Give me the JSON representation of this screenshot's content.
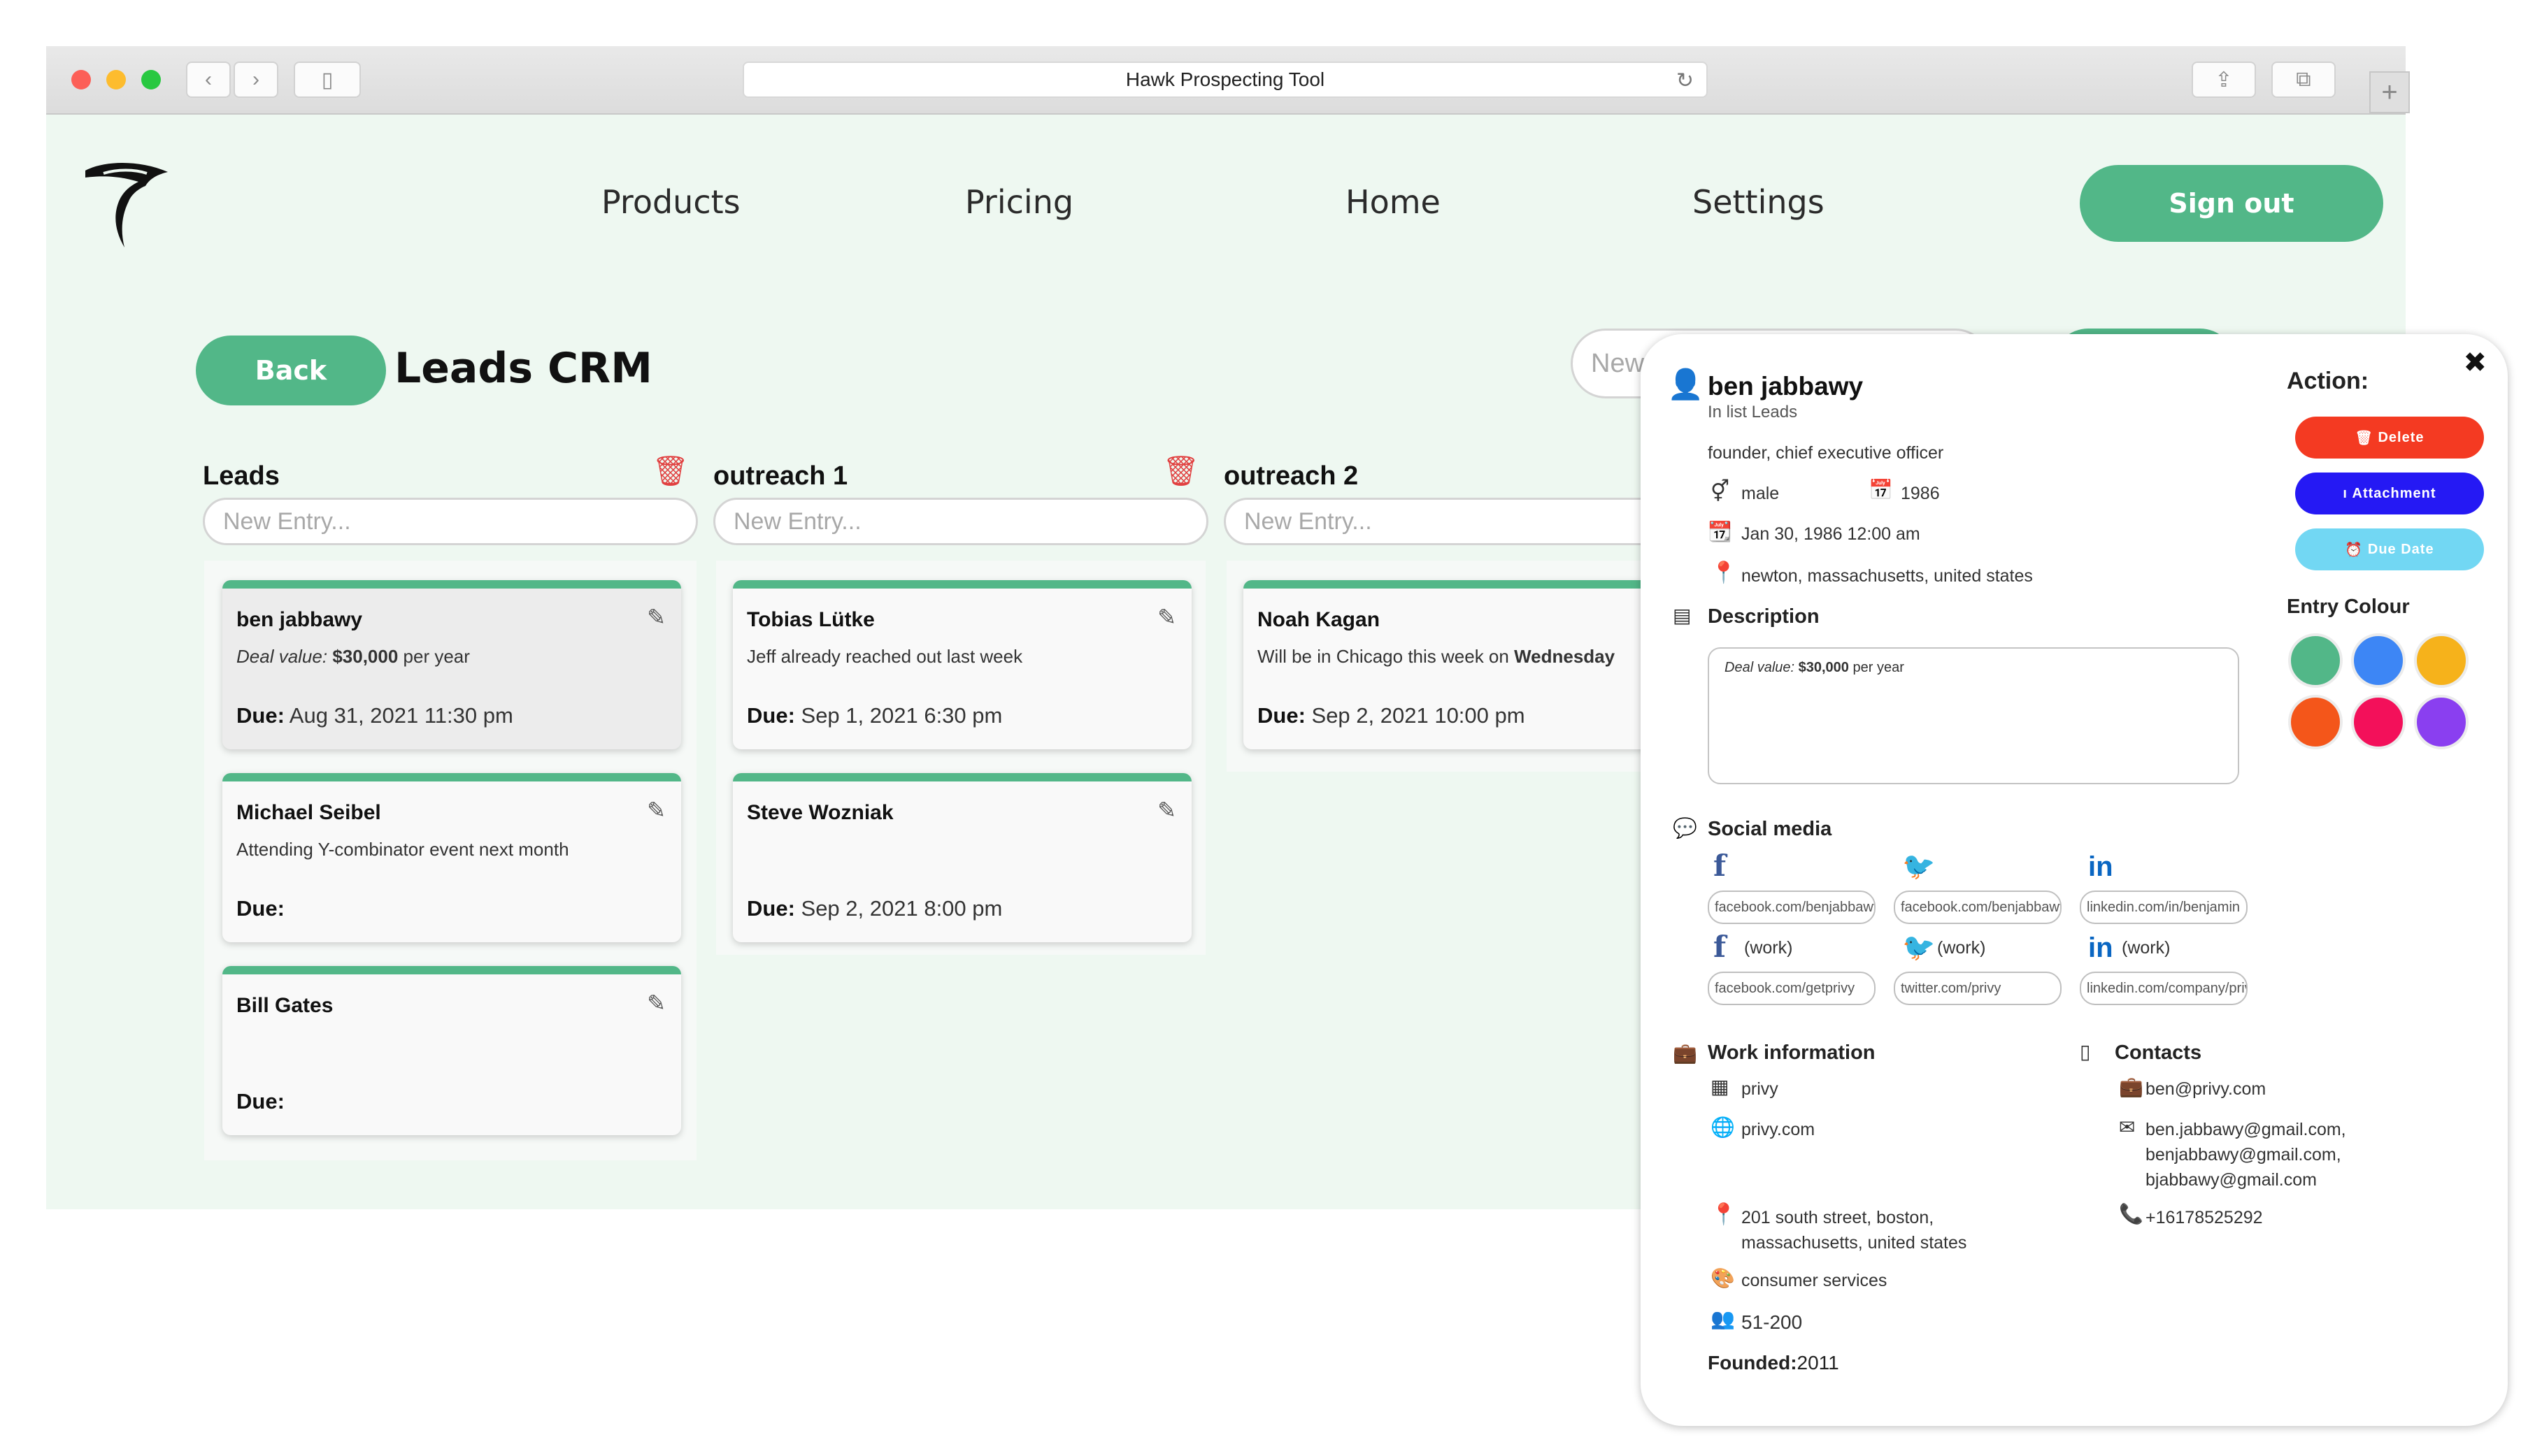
{
  "browser": {
    "url_title": "Hawk Prospecting Tool",
    "back_glyph": "‹",
    "forward_glyph": "›",
    "sidebar_glyph": "▯",
    "reload_glyph": "↻",
    "share_glyph": "⇪",
    "tabs_glyph": "⧉",
    "newtab_glyph": "+"
  },
  "nav": {
    "items": [
      "Products",
      "Pricing",
      "Home",
      "Settings"
    ],
    "signout_label": "Sign out"
  },
  "page": {
    "back_label": "Back",
    "title": "Leads CRM",
    "new_list_placeholder": "New"
  },
  "columns": [
    {
      "title": "Leads",
      "entry_placeholder": "New Entry...",
      "cards": [
        {
          "name": "ben jabbawy",
          "desc_prefix": "Deal value:",
          "desc_bold": "$30,000",
          "desc_suffix": "per year",
          "due_label": "Due:",
          "due_value": "Aug 31, 2021 11:30 pm"
        },
        {
          "name": "Michael Seibel",
          "desc": "Attending Y-combinator event next month",
          "due_label": "Due:",
          "due_value": ""
        },
        {
          "name": "Bill Gates",
          "desc": "",
          "due_label": "Due:",
          "due_value": ""
        }
      ]
    },
    {
      "title": "outreach 1",
      "entry_placeholder": "New Entry...",
      "cards": [
        {
          "name": "Tobias Lütke",
          "desc": "Jeff already reached out last week",
          "due_label": "Due:",
          "due_value": "Sep 1, 2021 6:30 pm"
        },
        {
          "name": "Steve Wozniak",
          "desc": "",
          "due_label": "Due:",
          "due_value": "Sep 2, 2021 8:00 pm"
        }
      ]
    },
    {
      "title": "outreach 2",
      "entry_placeholder": "New Entry...",
      "cards": [
        {
          "name": "Noah Kagan",
          "desc_prefix": "Will be in Chicago this week on",
          "desc_bold": "Wednesday",
          "due_label": "Due:",
          "due_value": "Sep 2, 2021 10:00 pm"
        }
      ]
    }
  ],
  "panel": {
    "close_glyph": "✖",
    "name": "ben jabbawy",
    "list_text": "In list Leads",
    "title_text": "founder, chief executive officer",
    "gender": "male",
    "birth_year": "1986",
    "birth_date": "Jan 30, 1986 12:00 am",
    "location": "newton, massachusetts, united states",
    "description_label": "Description",
    "description_prefix": "Deal value:",
    "description_bold": "$30,000",
    "description_suffix": "per year",
    "action_label": "Action:",
    "actions": {
      "delete": "Delete",
      "attachment": "Attachment",
      "due_date": "Due Date"
    },
    "entry_colour_label": "Entry Colour",
    "colours": [
      "#52b788",
      "#3d86f5",
      "#f6b21b",
      "#f4561a",
      "#f3105a",
      "#8a3ff0"
    ],
    "social_label": "Social media",
    "work_suffix": "(work)",
    "social": {
      "facebook": "facebook.com/benjabbawy",
      "twitter": "facebook.com/benjabbawy",
      "linkedin": "linkedin.com/in/benjamin",
      "facebook_work": "facebook.com/getprivy",
      "twitter_work": "twitter.com/privy",
      "linkedin_work": "linkedin.com/company/privy"
    },
    "work_label": "Work information",
    "company": "privy",
    "website": "privy.com",
    "work_address_1": "201 south street, boston,",
    "work_address_2": "massachusetts, united states",
    "industry": "consumer services",
    "employees": "51-200",
    "founded_label": "Founded:",
    "founded_value": "2011",
    "contacts_label": "Contacts",
    "work_email": "ben@privy.com",
    "emails": [
      "ben.jabbawy@gmail.com,",
      "benjabbawy@gmail.com,",
      "bjabbawy@gmail.com"
    ],
    "phone": "+16178525292"
  }
}
